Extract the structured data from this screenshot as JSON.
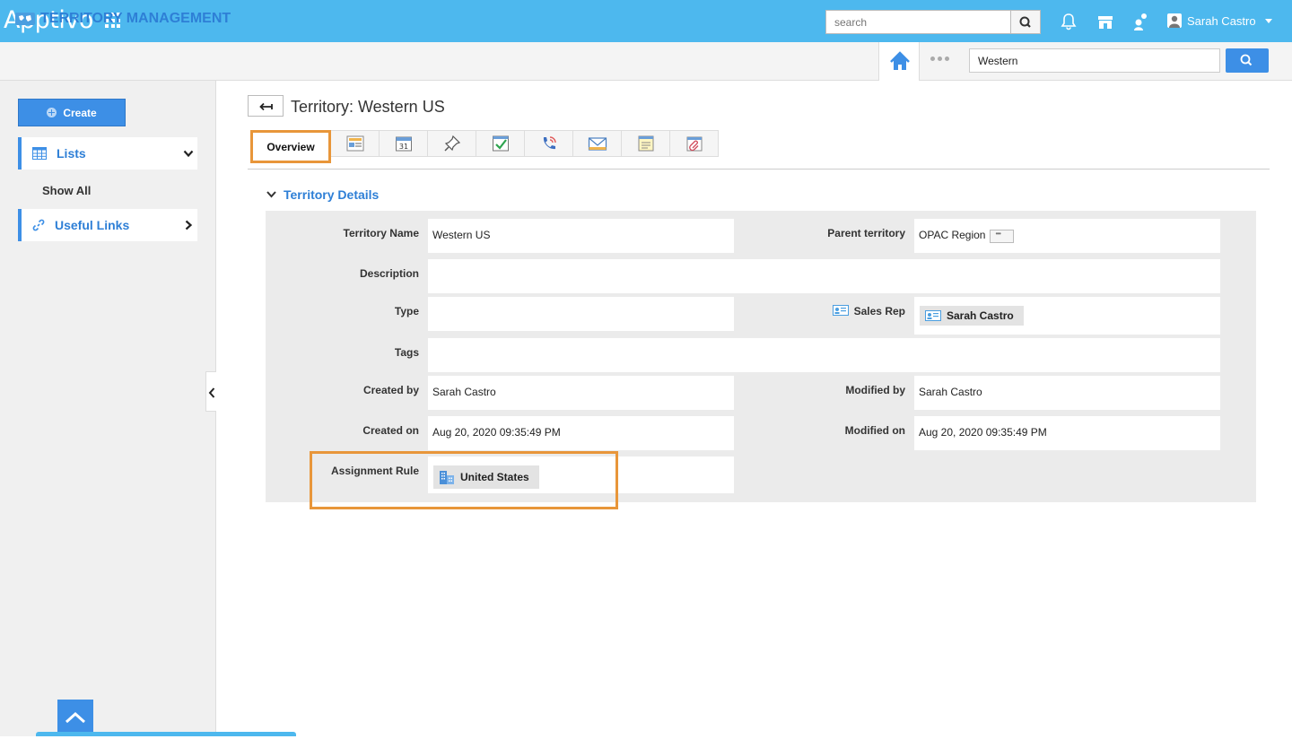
{
  "app": {
    "logo_text": "Apptivo"
  },
  "topbar": {
    "search_placeholder": "search",
    "user_name": "Sarah Castro"
  },
  "module": {
    "title": "TERRITORY MANAGEMENT",
    "global_search_value": "Western"
  },
  "sidebar": {
    "create_label": "Create",
    "lists_label": "Lists",
    "show_all_label": "Show All",
    "useful_links_label": "Useful Links"
  },
  "page": {
    "title": "Territory: Western US",
    "tabs": [
      {
        "label": "Overview",
        "active": true
      },
      {
        "icon": "notes-icon"
      },
      {
        "icon": "calendar-icon",
        "text": "31"
      },
      {
        "icon": "pin-icon"
      },
      {
        "icon": "task-check-icon"
      },
      {
        "icon": "call-icon"
      },
      {
        "icon": "email-icon"
      },
      {
        "icon": "note-icon"
      },
      {
        "icon": "attachment-icon"
      }
    ]
  },
  "details": {
    "section_title": "Territory Details",
    "territory_name_label": "Territory Name",
    "territory_name_value": "Western US",
    "parent_territory_label": "Parent territory",
    "parent_territory_value": "OPAC Region",
    "description_label": "Description",
    "description_value": "",
    "type_label": "Type",
    "type_value": "",
    "sales_rep_label": "Sales Rep",
    "sales_rep_value": "Sarah Castro",
    "tags_label": "Tags",
    "tags_value": "",
    "created_by_label": "Created by",
    "created_by_value": "Sarah Castro",
    "modified_by_label": "Modified by",
    "modified_by_value": "Sarah Castro",
    "created_on_label": "Created on",
    "created_on_value": "Aug 20, 2020 09:35:49 PM",
    "modified_on_label": "Modified on",
    "modified_on_value": "Aug 20, 2020 09:35:49 PM",
    "assignment_rule_label": "Assignment Rule",
    "assignment_rule_value": "United States"
  },
  "colors": {
    "topbar": "#4db8ee",
    "accent": "#3d8fe6",
    "highlight": "#e8963a"
  }
}
